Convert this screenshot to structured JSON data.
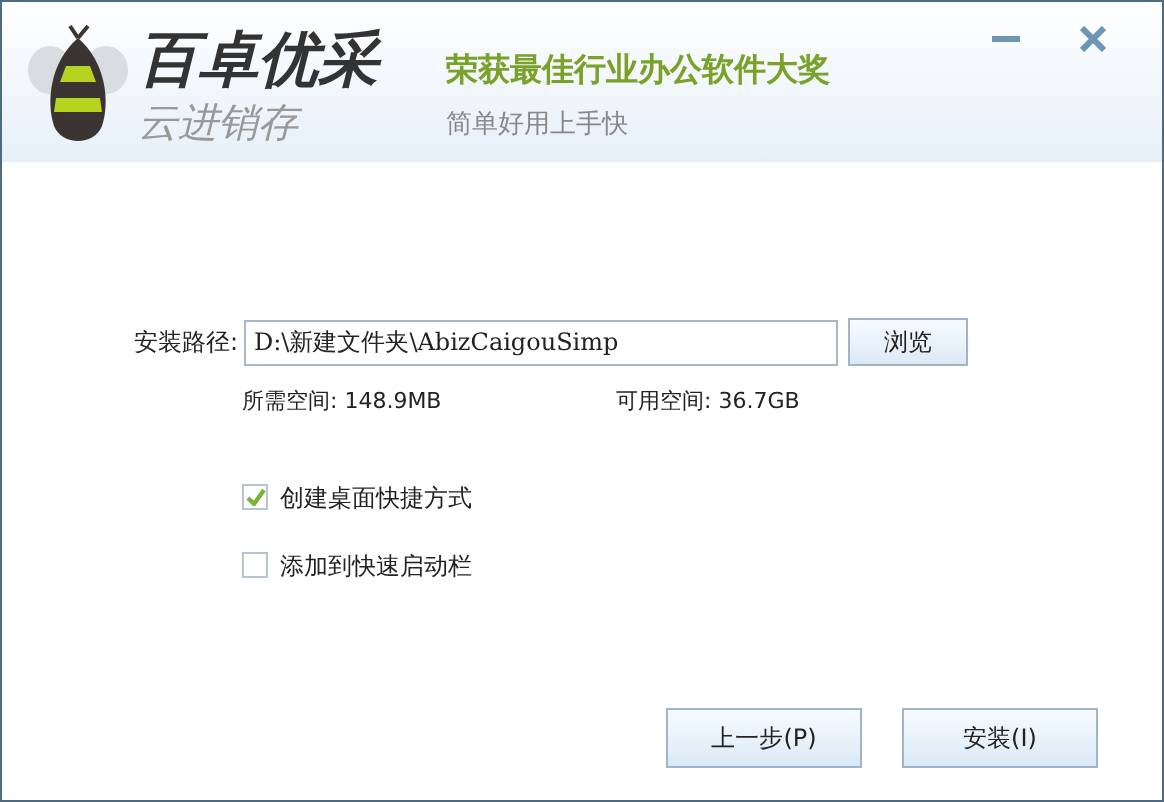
{
  "header": {
    "logo_title": "百卓优采",
    "logo_subtitle": "云进销存",
    "slogan": "荣获最佳行业办公软件大奖",
    "tagline": "简单好用上手快"
  },
  "install_path": {
    "label": "安装路径:",
    "value": "D:\\新建文件夹\\AbizCaigouSimp",
    "browse_button": "浏览"
  },
  "space": {
    "required": "所需空间: 148.9MB",
    "available": "可用空间: 36.7GB"
  },
  "options": [
    {
      "label": "创建桌面快捷方式",
      "checked": true
    },
    {
      "label": "添加到快速启动栏",
      "checked": false
    }
  ],
  "buttons": [
    {
      "label": "上一步(P)"
    },
    {
      "label": "安装(I)"
    }
  ]
}
